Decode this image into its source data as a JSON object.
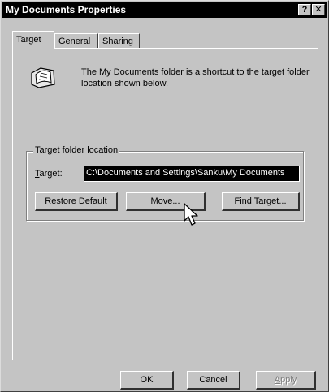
{
  "window": {
    "title": "My Documents Properties",
    "help_glyph": "?",
    "close_glyph": "✕"
  },
  "tabs": [
    {
      "label": "Target",
      "active": true
    },
    {
      "label": "General",
      "active": false
    },
    {
      "label": "Sharing",
      "active": false
    }
  ],
  "panel": {
    "icon": "my-documents-folder-icon",
    "description": "The My Documents folder is a shortcut to the target folder location shown below."
  },
  "target_group": {
    "label": "Target folder location",
    "target_label_prefix": "T",
    "target_label_rest": "arget:",
    "target_value": "C:\\Documents and Settings\\Sanku\\My Documents"
  },
  "buttons": {
    "restore_u": "R",
    "restore_rest": "estore Default",
    "move_u": "M",
    "move_rest": "ove...",
    "find_u": "F",
    "find_rest": "ind Target...",
    "ok": "OK",
    "cancel": "Cancel",
    "apply_u": "A",
    "apply_rest": "pply",
    "apply_enabled": false
  },
  "cursor": "arrow-pointer-icon"
}
